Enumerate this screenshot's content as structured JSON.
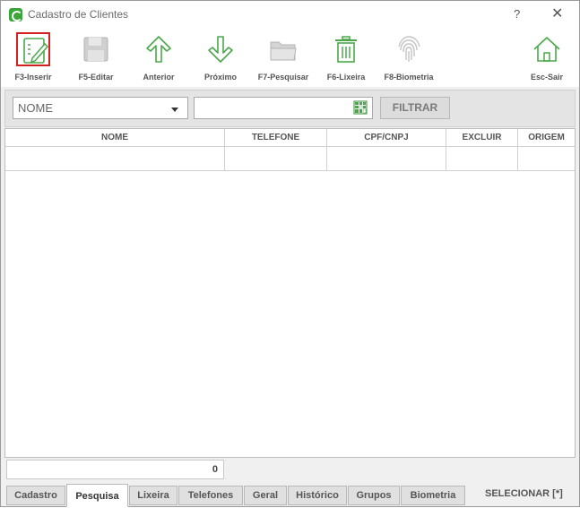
{
  "window": {
    "title": "Cadastro de Clientes",
    "help_label": "?",
    "close_label": "✕"
  },
  "toolbar": {
    "items": [
      {
        "label": "F3-Inserir",
        "icon": "edit-form-icon"
      },
      {
        "label": "F5-Editar",
        "icon": "save-disk-icon"
      },
      {
        "label": "Anterior",
        "icon": "arrow-up-icon"
      },
      {
        "label": "Próximo",
        "icon": "arrow-down-icon"
      },
      {
        "label": "F7-Pesquisar",
        "icon": "folder-icon"
      },
      {
        "label": "F6-Lixeira",
        "icon": "trash-icon"
      },
      {
        "label": "F8-Biometria",
        "icon": "fingerprint-icon"
      },
      {
        "label": "Esc-Sair",
        "icon": "home-icon"
      }
    ]
  },
  "filter": {
    "field_value": "NOME",
    "search_value": "",
    "button_label": "FILTRAR"
  },
  "table": {
    "columns": [
      "NOME",
      "TELEFONE",
      "CPF/CNPJ",
      "EXCLUIR",
      "ORIGEM"
    ],
    "rows": [
      [
        "",
        "",
        "",
        "",
        ""
      ]
    ]
  },
  "footer": {
    "count": "0"
  },
  "tabs": {
    "items": [
      "Cadastro",
      "Pesquisa",
      "Lixeira",
      "Telefones",
      "Geral",
      "Histórico",
      "Grupos",
      "Biometria"
    ],
    "active": "Pesquisa",
    "select_label": "SELECIONAR [*]"
  },
  "colors": {
    "accent_green": "#3aa63a",
    "selected_border": "#d42020",
    "disabled_gray": "#a8a8a8"
  }
}
